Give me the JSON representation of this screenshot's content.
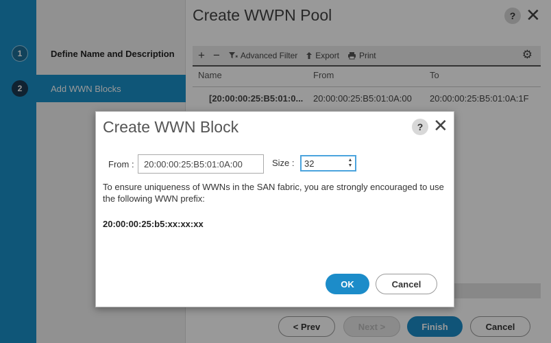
{
  "wizard": {
    "title": "Create WWPN Pool",
    "help_icon": "?",
    "close_icon": "✕",
    "steps": [
      {
        "num": "1",
        "label": "Define Name and Description"
      },
      {
        "num": "2",
        "label": "Add WWN Blocks"
      }
    ],
    "toolbar": {
      "add_icon": "+",
      "remove_icon": "−",
      "filter_label": "Advanced Filter",
      "export_label": "Export",
      "print_label": "Print",
      "settings_icon": "⚙"
    },
    "table": {
      "columns": [
        "Name",
        "From",
        "To"
      ],
      "rows": [
        {
          "name": "[20:00:00:25:B5:01:0...",
          "from": "20:00:00:25:B5:01:0A:00",
          "to": "20:00:00:25:B5:01:0A:1F"
        }
      ]
    },
    "buttons": {
      "prev": "< Prev",
      "next": "Next >",
      "finish": "Finish",
      "cancel": "Cancel"
    }
  },
  "modal": {
    "title": "Create WWN Block",
    "help_icon": "?",
    "close_icon": "✕",
    "from_label": "From :",
    "from_value": "20:00:00:25:B5:01:0A:00",
    "size_label": "Size :",
    "size_value": "32",
    "message": "To ensure uniqueness of WWNs in the SAN fabric, you are strongly encouraged to use the following WWN prefix:",
    "prefix": "20:00:00:25:b5:xx:xx:xx",
    "ok_label": "OK",
    "cancel_label": "Cancel"
  },
  "colors": {
    "accent": "#1c8cc9",
    "rail": "#1a8fc8"
  }
}
